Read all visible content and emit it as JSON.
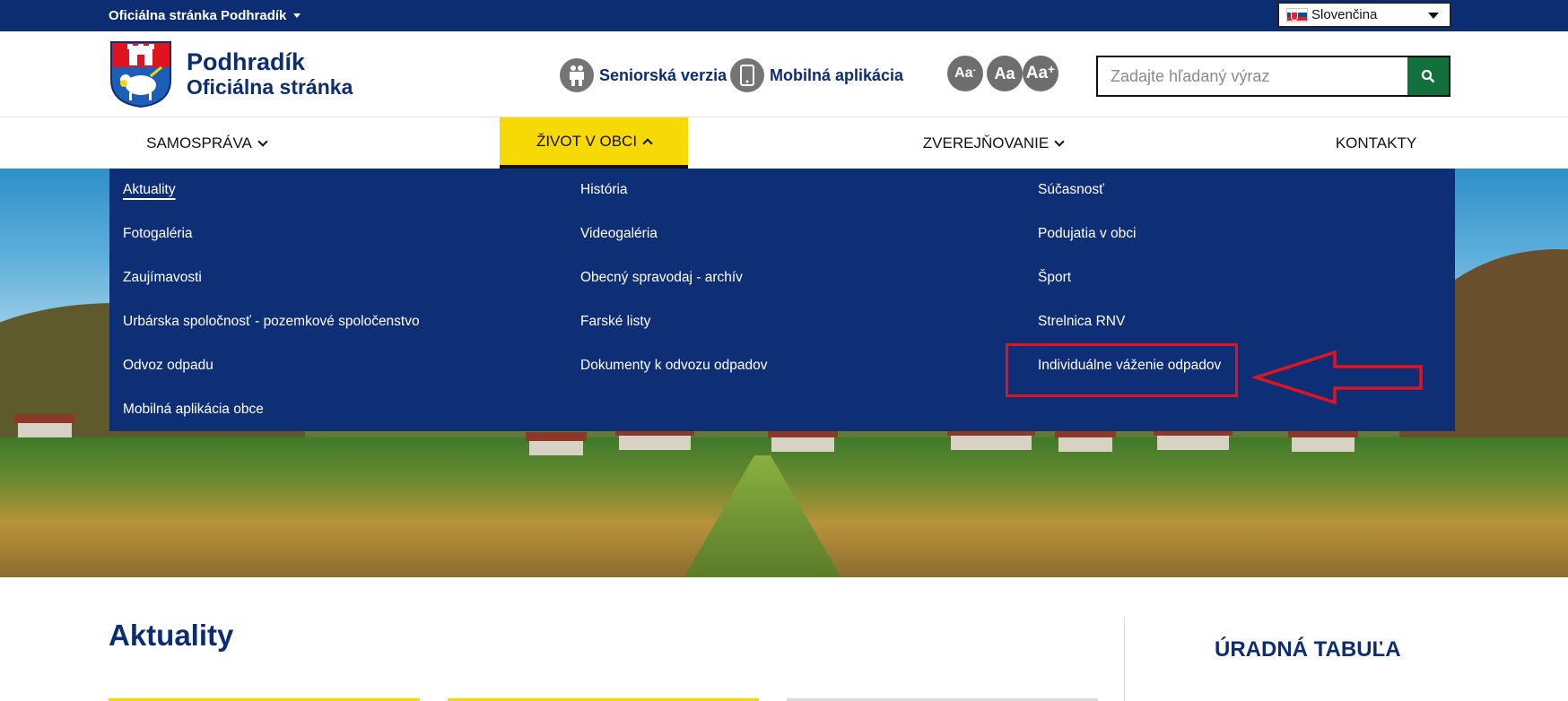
{
  "topbar": {
    "site_switch_label": "Oficiálna stránka Podhradík",
    "language": "Slovenčina"
  },
  "header": {
    "name": "Podhradík",
    "subtitle": "Oficiálna stránka",
    "senior_label": "Seniorská verzia",
    "mobile_label": "Mobilná aplikácia",
    "font_small": "Aa",
    "font_normal": "Aa",
    "font_large": "Aa",
    "search_placeholder": "Zadajte hľadaný výraz"
  },
  "nav": {
    "items": [
      {
        "label": "SAMOSPRÁVA",
        "state": "collapsed"
      },
      {
        "label": "ŽIVOT V OBCI",
        "state": "expanded"
      },
      {
        "label": "ZVEREJŇOVANIE",
        "state": "collapsed"
      },
      {
        "label": "KONTAKTY"
      }
    ]
  },
  "dropdown": {
    "col1": [
      "Aktuality",
      "Fotogaléria",
      "Zaujímavosti",
      "Urbárska spoločnosť - pozemkové spoločenstvo",
      "Odvoz odpadu",
      "Mobilná aplikácia obce"
    ],
    "col2": [
      "História",
      "Videogaléria",
      "Obecný spravodaj - archív",
      "Farské listy",
      "Dokumenty k odvozu odpadov"
    ],
    "col3": [
      "Súčasnosť",
      "Podujatia v obci",
      "Šport",
      "Strelnica RNV",
      "Individuálne váženie odpadov"
    ]
  },
  "main": {
    "title": "Aktuality",
    "sidebar_title": "ÚRADNÁ TABUĽA"
  },
  "colors": {
    "brand_navy": "#0d2d73",
    "accent_yellow": "#f7d905",
    "search_green": "#12703d",
    "annotation_red": "#e0141e"
  },
  "icons": [
    "caret-down-icon",
    "slovak-flag-icon",
    "coat-of-arms-icon",
    "senior-couple-icon",
    "phone-icon",
    "search-icon",
    "chevron-down-icon",
    "chevron-up-icon",
    "annotation-arrow-icon"
  ]
}
